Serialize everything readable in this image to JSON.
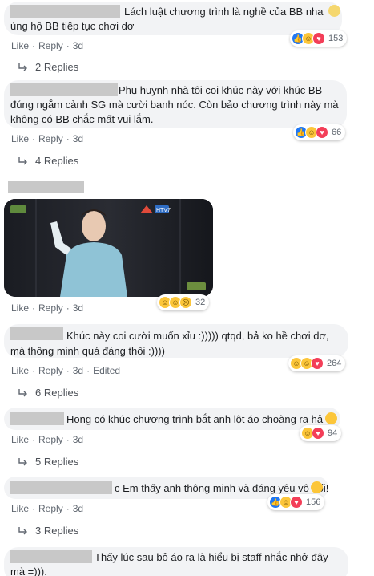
{
  "common": {
    "like": "Like",
    "reply": "Reply",
    "sep": "·"
  },
  "comments": [
    {
      "text1": "Lách luật chương trình là nghề của BB nha",
      "text2": "ủng hộ BB tiếp tục chơi dơ",
      "time": "3d",
      "count": "153",
      "replies": "2 Replies"
    },
    {
      "text1": "Phụ huynh nhà tôi coi khúc này với khúc BB",
      "text2": "đúng ngắm cảnh SG mà cười banh nóc. Còn bảo chương trình này mà",
      "text3": "không có BB chắc mất vui lắm.",
      "time": "3d",
      "count": "66",
      "replies": "4 Replies"
    },
    {
      "time": "3d",
      "count": "32"
    },
    {
      "text1": "Khúc này coi cười muốn xỉu :))))) qtqd, bả ko hề chơi dơ,",
      "text2": "mà thông minh quá đáng thôi :))))",
      "time": "3d",
      "edited": "Edited",
      "count": "264",
      "replies": "6 Replies"
    },
    {
      "text1": "Hong có khúc chương trình bắt anh lột áo choàng ra hả",
      "time": "3d",
      "count": "94",
      "replies": "5 Replies"
    },
    {
      "text1": "c Em thấy anh thông minh và đáng yêu vô đối!",
      "time": "3d",
      "count": "156",
      "replies": "3 Replies"
    },
    {
      "text1": "Thấy lúc sau bỏ áo ra là hiểu bị staff nhắc nhở đây",
      "text2": "mà =)))."
    }
  ],
  "photo": {
    "logo": "HTV7"
  },
  "colors": {
    "bubble": "#f2f3f5",
    "like": "#2078f4",
    "love": "#f33e58",
    "haha": "#fcc63a",
    "muted": "#606770"
  }
}
